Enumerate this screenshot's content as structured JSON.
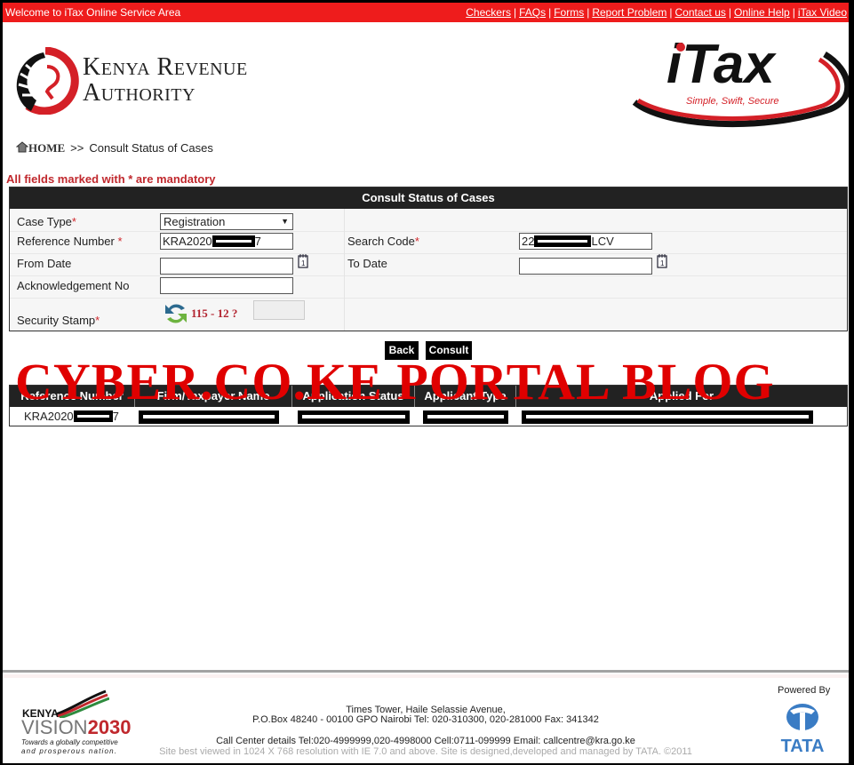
{
  "topbar": {
    "welcome": "Welcome to iTax Online Service Area",
    "links": [
      "Checkers",
      "FAQs",
      "Forms",
      "Report Problem",
      "Contact us",
      "Online Help",
      "iTax Video"
    ]
  },
  "header": {
    "kra_line1": "Kenya Revenue",
    "kra_line2": "Authority",
    "itax_brand": "iTax",
    "itax_tagline": "Simple, Swift, Secure"
  },
  "breadcrumb": {
    "home": "HOME",
    "separator": ">>",
    "current": "Consult Status of Cases"
  },
  "mandatory_note": "All fields marked with * are mandatory",
  "form": {
    "title": "Consult Status of Cases",
    "case_type": {
      "label": "Case Type",
      "required": "*",
      "value": "Registration"
    },
    "reference_number": {
      "label": "Reference Number ",
      "required": "*",
      "value_prefix": "KRA2020",
      "value_suffix": "7"
    },
    "search_code": {
      "label": "Search Code",
      "required": "*",
      "value_prefix": "22",
      "value_suffix": "LCV"
    },
    "from_date": {
      "label": "From Date",
      "value": ""
    },
    "to_date": {
      "label": "To Date",
      "value": ""
    },
    "acknowledgement_no": {
      "label": "Acknowledgement No",
      "value": ""
    },
    "security_stamp": {
      "label": "Security Stamp",
      "required": "*",
      "challenge": "115  - 12 ?",
      "value": ""
    }
  },
  "buttons": {
    "back": "Back",
    "consult": "Consult"
  },
  "watermark": "CYBER.CO.KE PORTAL BLOG",
  "results": {
    "columns": [
      "Reference Number",
      "Firm/Taxpayer Name",
      "Application Status",
      "Applicant Type",
      "Applied For"
    ],
    "rows": [
      {
        "reference_prefix": "KRA2020",
        "reference_suffix": "7"
      }
    ]
  },
  "footer": {
    "vision_kenya": "KENYA",
    "vision_word": "VISION",
    "vision_year": "2030",
    "vision_tag1": "Towards a globally competitive",
    "vision_tag2": "and prosperous nation.",
    "address1": "Times Tower, Haile Selassie Avenue,",
    "address2": "P.O.Box 48240 - 00100 GPO Nairobi Tel: 020-310300, 020-281000 Fax: 341342",
    "callcenter": "Call Center details Tel:020-4999999,020-4998000 Cell:0711-099999 Email: callcentre@kra.go.ke",
    "site_note": "Site best viewed in 1024 X 768 resolution with IE 7.0 and above. Site is designed,developed and managed by TATA. ©2011",
    "powered_by": "Powered By",
    "tata": "TATA"
  }
}
